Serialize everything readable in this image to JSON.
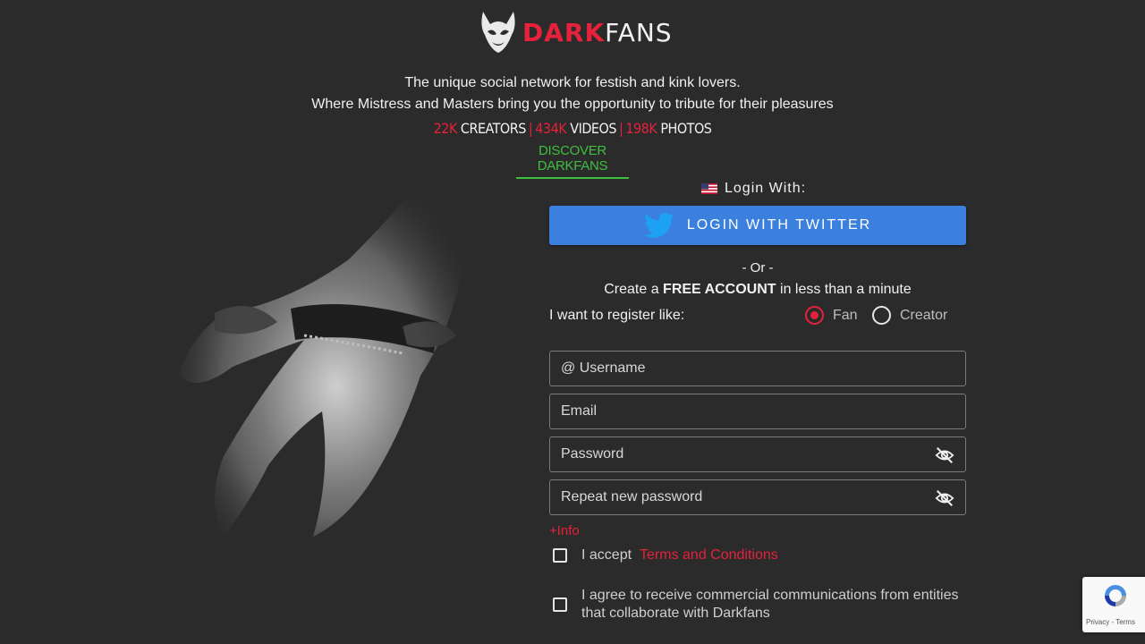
{
  "brand": {
    "dark": "DARK",
    "fans": "FANS",
    "accent": "#e5213b"
  },
  "tagline": {
    "line1": "The unique social network for festish and kink lovers.",
    "line2": "Where Mistress and Masters bring you the opportunity to tribute for their pleasures"
  },
  "stats": [
    {
      "num": "22K",
      "label": "CREATORS"
    },
    {
      "num": "434K",
      "label": "VIDEOS"
    },
    {
      "num": "198K",
      "label": "PHOTOS"
    }
  ],
  "discover": "DISCOVER DARKFANS",
  "login": {
    "login_with": "Login With:",
    "twitter_button": "LOGIN WITH TWITTER",
    "or": "- Or -"
  },
  "create": {
    "prefix": "Create a ",
    "bold": "FREE ACCOUNT",
    "suffix": " in less than a minute"
  },
  "register": {
    "label": "I want to register like:",
    "options": [
      "Fan",
      "Creator"
    ],
    "selected": "Fan"
  },
  "form": {
    "username_placeholder": "@ Username",
    "email_placeholder": "Email",
    "password_placeholder": "Password",
    "repeat_placeholder": "Repeat new password",
    "info_link": "+Info",
    "accept_prefix": "I accept",
    "terms_link": "Terms and Conditions",
    "commercial": "I agree to receive commercial communications from entities that collaborate with Darkfans"
  },
  "recaptcha": {
    "links": "Privacy - Terms"
  },
  "colors": {
    "background": "#2b2b2b",
    "twitter": "#3b7fdf",
    "discover": "#3fbf3f",
    "accent": "#e5213b"
  }
}
